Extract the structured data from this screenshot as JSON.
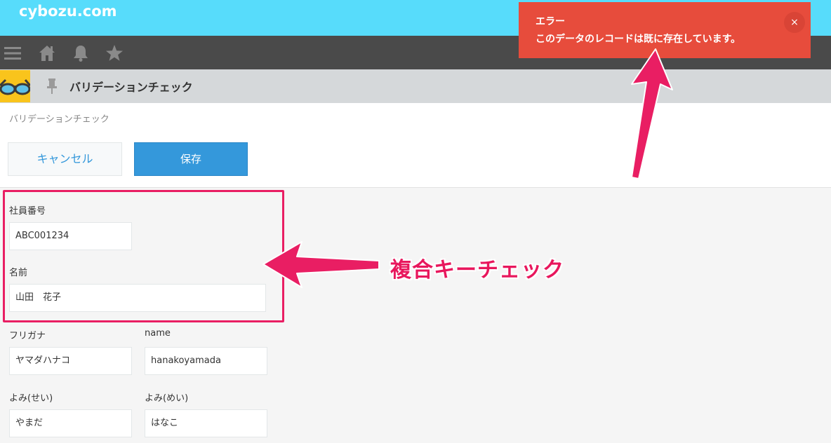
{
  "header": {
    "logo": "cybozu.com"
  },
  "nav": {
    "icons": [
      "menu-icon",
      "home-icon",
      "bell-icon",
      "star-icon"
    ]
  },
  "app": {
    "title": "バリデーションチェック"
  },
  "breadcrumb": "バリデーションチェック",
  "toolbar": {
    "cancel_label": "キャンセル",
    "save_label": "保存"
  },
  "form": {
    "employee_no": {
      "label": "社員番号",
      "value": "ABC001234"
    },
    "name": {
      "label": "名前",
      "value": "山田　花子"
    },
    "furigana": {
      "label": "フリガナ",
      "value": "ヤマダハナコ"
    },
    "name_en": {
      "label": "name",
      "value": "hanakoyamada"
    },
    "yomi_sei": {
      "label": "よみ(せい)",
      "value": "やまだ"
    },
    "yomi_mei": {
      "label": "よみ(めい)",
      "value": "はなこ"
    }
  },
  "annotation": {
    "label": "複合キーチェック"
  },
  "error": {
    "title": "エラー",
    "message": "このデータのレコードは既に存在しています。",
    "close_label": "×"
  },
  "colors": {
    "header": "#57dcfb",
    "nav": "#4a4a4a",
    "primary": "#3498db",
    "error": "#e74c3c",
    "annotation": "#e91e63"
  }
}
